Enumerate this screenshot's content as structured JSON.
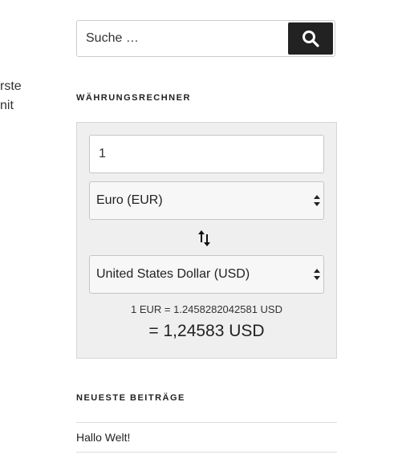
{
  "left_fragment": {
    "line1": "rste",
    "line2": "nit"
  },
  "search": {
    "placeholder": "Suche …",
    "button_icon": "search-icon"
  },
  "currency_widget": {
    "title": "WÄHRUNGSRECHNER",
    "amount": "1",
    "from_currency": "Euro (EUR)",
    "to_currency": "United States Dollar (USD)",
    "swap_icon": "swap-arrows-icon",
    "rate_text": "1 EUR = 1.2458282042581 USD",
    "result_text": "= 1,24583 USD"
  },
  "recent_posts": {
    "title": "NEUESTE BEITRÄGE",
    "items": [
      {
        "label": "Hallo Welt!"
      }
    ]
  },
  "colors": {
    "button_bg": "#222222",
    "widget_bg": "#efefef"
  }
}
